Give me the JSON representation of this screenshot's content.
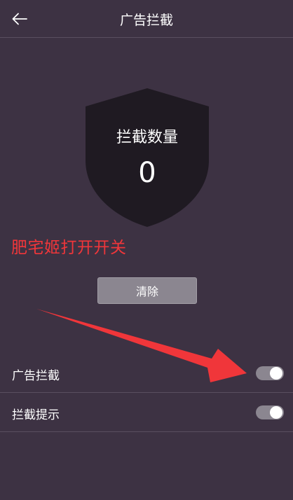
{
  "header": {
    "title": "广告拦截",
    "back_icon": "back-arrow-icon"
  },
  "shield": {
    "label": "拦截数量",
    "count": "0",
    "color": "#1f1a22"
  },
  "annotation": {
    "text": "肥宅姬打开开关",
    "color": "#f0363a"
  },
  "clear_button": {
    "label": "清除"
  },
  "settings": [
    {
      "label": "广告拦截",
      "enabled": true
    },
    {
      "label": "拦截提示",
      "enabled": true
    }
  ],
  "colors": {
    "background": "#3d3243",
    "divider": "#5a4f60",
    "toggle_track": "#8b8690",
    "arrow": "#f0363a"
  }
}
